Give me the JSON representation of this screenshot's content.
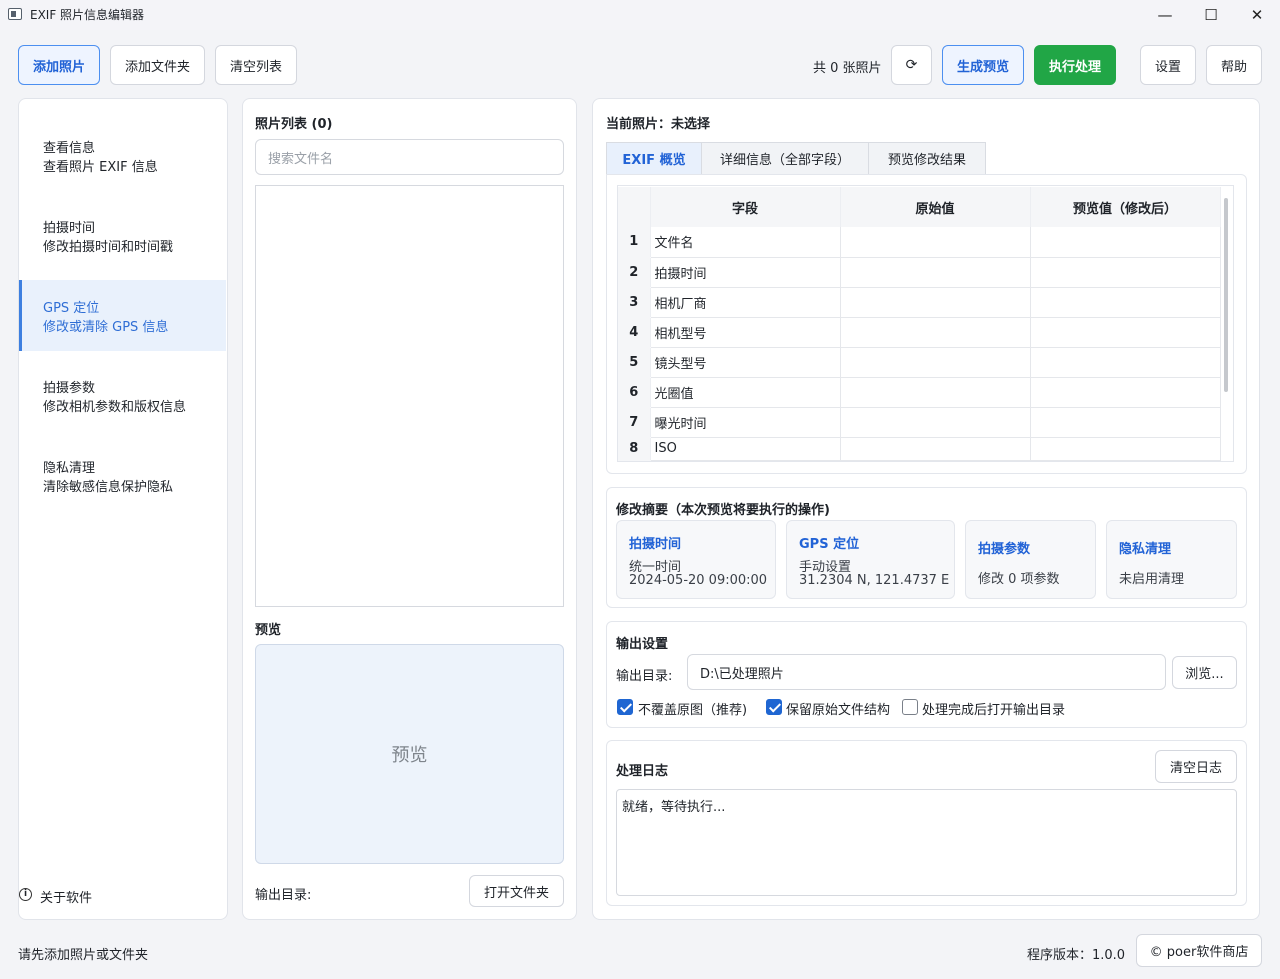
{
  "window": {
    "title": "EXIF 照片信息编辑器",
    "minimize": "—",
    "maximize": "☐",
    "close": "✕"
  },
  "toolbar": {
    "add_photos": "添加照片",
    "add_folder": "添加文件夹",
    "clear_list": "清空列表",
    "photo_count": "共 0 张照片",
    "refresh_icon": "⟳",
    "generate_preview": "生成预览",
    "execute": "执行处理",
    "settings": "设置",
    "help": "帮助"
  },
  "sidebar": {
    "items": [
      {
        "title": "查看信息",
        "subtitle": "查看照片 EXIF 信息",
        "active": false
      },
      {
        "title": "拍摄时间",
        "subtitle": "修改拍摄时间和时间戳",
        "active": false
      },
      {
        "title": "GPS 定位",
        "subtitle": "修改或清除 GPS 信息",
        "active": true
      },
      {
        "title": "拍摄参数",
        "subtitle": "修改相机参数和版权信息",
        "active": false
      },
      {
        "title": "隐私清理",
        "subtitle": "清除敏感信息保护隐私",
        "active": false
      }
    ],
    "about": "关于软件",
    "about_icon": "info-icon"
  },
  "photo_list": {
    "title": "照片列表 (0)",
    "search_placeholder": "搜索文件名",
    "preview_title": "预览",
    "preview_placeholder": "预览",
    "output_dir_label": "输出目录:",
    "open_folder": "打开文件夹"
  },
  "detail": {
    "current_photo": "当前照片：未选择",
    "tabs": [
      "EXIF 概览",
      "详细信息（全部字段）",
      "预览修改结果"
    ],
    "active_tab": 0,
    "columns": [
      "字段",
      "原始值",
      "预览值（修改后）"
    ],
    "rows": [
      {
        "num": "1",
        "field": "文件名",
        "original": "",
        "preview": ""
      },
      {
        "num": "2",
        "field": "拍摄时间",
        "original": "",
        "preview": ""
      },
      {
        "num": "3",
        "field": "相机厂商",
        "original": "",
        "preview": ""
      },
      {
        "num": "4",
        "field": "相机型号",
        "original": "",
        "preview": ""
      },
      {
        "num": "5",
        "field": "镜头型号",
        "original": "",
        "preview": ""
      },
      {
        "num": "6",
        "field": "光圈值",
        "original": "",
        "preview": ""
      },
      {
        "num": "7",
        "field": "曝光时间",
        "original": "",
        "preview": ""
      },
      {
        "num": "8",
        "field": "ISO",
        "original": "",
        "preview": ""
      }
    ]
  },
  "summary": {
    "title": "修改摘要（本次预览将要执行的操作)",
    "cards": [
      {
        "title": "拍摄时间",
        "lines": [
          "统一时间",
          "2024-05-20 09:00:00"
        ]
      },
      {
        "title": "GPS 定位",
        "lines": [
          "手动设置",
          "31.2304 N, 121.4737 E"
        ]
      },
      {
        "title": "拍摄参数",
        "lines": [
          "修改 0 项参数"
        ]
      },
      {
        "title": "隐私清理",
        "lines": [
          "未启用清理"
        ]
      }
    ]
  },
  "output": {
    "title": "输出设置",
    "dir_label": "输出目录:",
    "dir_value": "D:\\已处理照片",
    "browse": "浏览...",
    "options": [
      {
        "label": "不覆盖原图（推荐)",
        "checked": true
      },
      {
        "label": "保留原始文件结构",
        "checked": true
      },
      {
        "label": "处理完成后打开输出目录",
        "checked": false
      }
    ]
  },
  "log": {
    "title": "处理日志",
    "clear": "清空日志",
    "content": "就绪，等待执行..."
  },
  "statusbar": {
    "message": "请先添加照片或文件夹",
    "version": "程序版本：1.0.0",
    "store": "© poer软件商店"
  }
}
